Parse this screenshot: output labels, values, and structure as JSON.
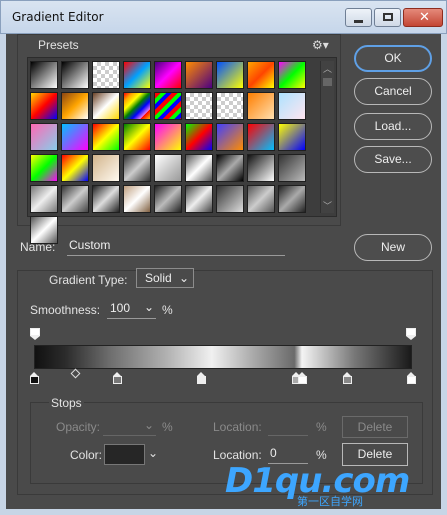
{
  "window": {
    "title": "Gradient Editor"
  },
  "presets": {
    "label": "Presets",
    "gear_icon": "gear-icon",
    "swatches": [
      "linear-gradient(135deg,#000,#fff)",
      "linear-gradient(135deg,#000,#fff)",
      "repeating-conic-gradient(#ccc 0 25%,#fff 0 50%) 0 0/8px 8px",
      "linear-gradient(135deg,#ff0000,#00a0ff,#ffff00)",
      "linear-gradient(135deg,#4b0082,#ff00ff,#ff0000)",
      "linear-gradient(135deg,#ff8c00,#4b0082)",
      "linear-gradient(135deg,#0050ff,#ffff00)",
      "linear-gradient(135deg,#ffa500,#ff4500,#ffff00)",
      "linear-gradient(135deg,#ff00ff,#00ff00,#ffff00)",
      "linear-gradient(135deg,#ffd700,#ff0000,#0000ff)",
      "linear-gradient(135deg,#8b4513,#ffa500,#fff)",
      "linear-gradient(135deg,#6b4226,#ffffff,#ffd700)",
      "repeating-linear-gradient(135deg,red,orange,yellow,green,blue,violet 30px)",
      "repeating-linear-gradient(135deg,#ff0000 0 4px,#00ff00 4px 8px,#0000ff 8px 12px)",
      "repeating-conic-gradient(#ccc 0 25%,#fff 0 50%) 0 0/8px 8px",
      "repeating-conic-gradient(#ccc 0 25%,#fff 0 50%) 0 0/8px 8px",
      "linear-gradient(135deg,#ff7e00,#ffe0b0)",
      "linear-gradient(135deg,#aee3ff,#ffe4f0)",
      "linear-gradient(135deg,#ff69b4,#87ceeb)",
      "linear-gradient(135deg,#00c0ff,#ff00ff)",
      "linear-gradient(135deg,#ff0000,#ffff00,#00ff00)",
      "linear-gradient(135deg,#008000,#ffff00,#ff0000)",
      "linear-gradient(135deg,#ff00ff,#ffff00)",
      "linear-gradient(135deg,#00ff00,#ff0000,#0000ff)",
      "linear-gradient(135deg,#4040ff,#ff8c00)",
      "linear-gradient(135deg,#ff0000,#00c0ff)",
      "linear-gradient(135deg,#ffff00,#0000ff)",
      "linear-gradient(135deg,#ffff00,#00ff00,#ff00ff)",
      "linear-gradient(135deg,#ff0000,#ffff00,#0000ff)",
      "linear-gradient(135deg,#d2b48c,#fffaf0)",
      "linear-gradient(135deg,#333,#ccc,#333)",
      "linear-gradient(135deg,#fff,#999)",
      "linear-gradient(135deg,#555,#fff,#555)",
      "linear-gradient(135deg,#000,#aaa,#000)",
      "linear-gradient(135deg,#111,#fff)",
      "linear-gradient(135deg,#333,#bbb)",
      "linear-gradient(135deg,#777,#eee,#777)",
      "linear-gradient(135deg,#333,#ccc,#444)",
      "linear-gradient(135deg,#222,#ddd,#222)",
      "linear-gradient(135deg,#c0a080,#fff,#806040)",
      "linear-gradient(135deg,#222,#bbb,#222)",
      "linear-gradient(135deg,#444,#eee,#444)",
      "linear-gradient(135deg,#333,#ddd)",
      "linear-gradient(135deg,#555,#ccc,#555)",
      "linear-gradient(135deg,#222,#aaa,#222)",
      "linear-gradient(135deg,#555,#fff,#555)"
    ]
  },
  "buttons": {
    "ok": "OK",
    "cancel": "Cancel",
    "load": "Load...",
    "save": "Save...",
    "new": "New"
  },
  "name": {
    "label": "Name:",
    "value": "Custom"
  },
  "gradient": {
    "type_label": "Gradient Type:",
    "type_value": "Solid",
    "smoothness_label": "Smoothness:",
    "smoothness_value": "100",
    "smoothness_unit": "%"
  },
  "stops": {
    "label": "Stops",
    "opacity_label": "Opacity:",
    "opacity_unit": "%",
    "location_label_opacity": "Location:",
    "location_unit_opacity": "%",
    "delete_opacity": "Delete",
    "color_label": "Color:",
    "location_label_color": "Location:",
    "location_value": "0",
    "location_unit_color": "%",
    "delete_color": "Delete"
  },
  "watermark": {
    "main": "D1qu.com",
    "sub": "第一区自学网"
  }
}
